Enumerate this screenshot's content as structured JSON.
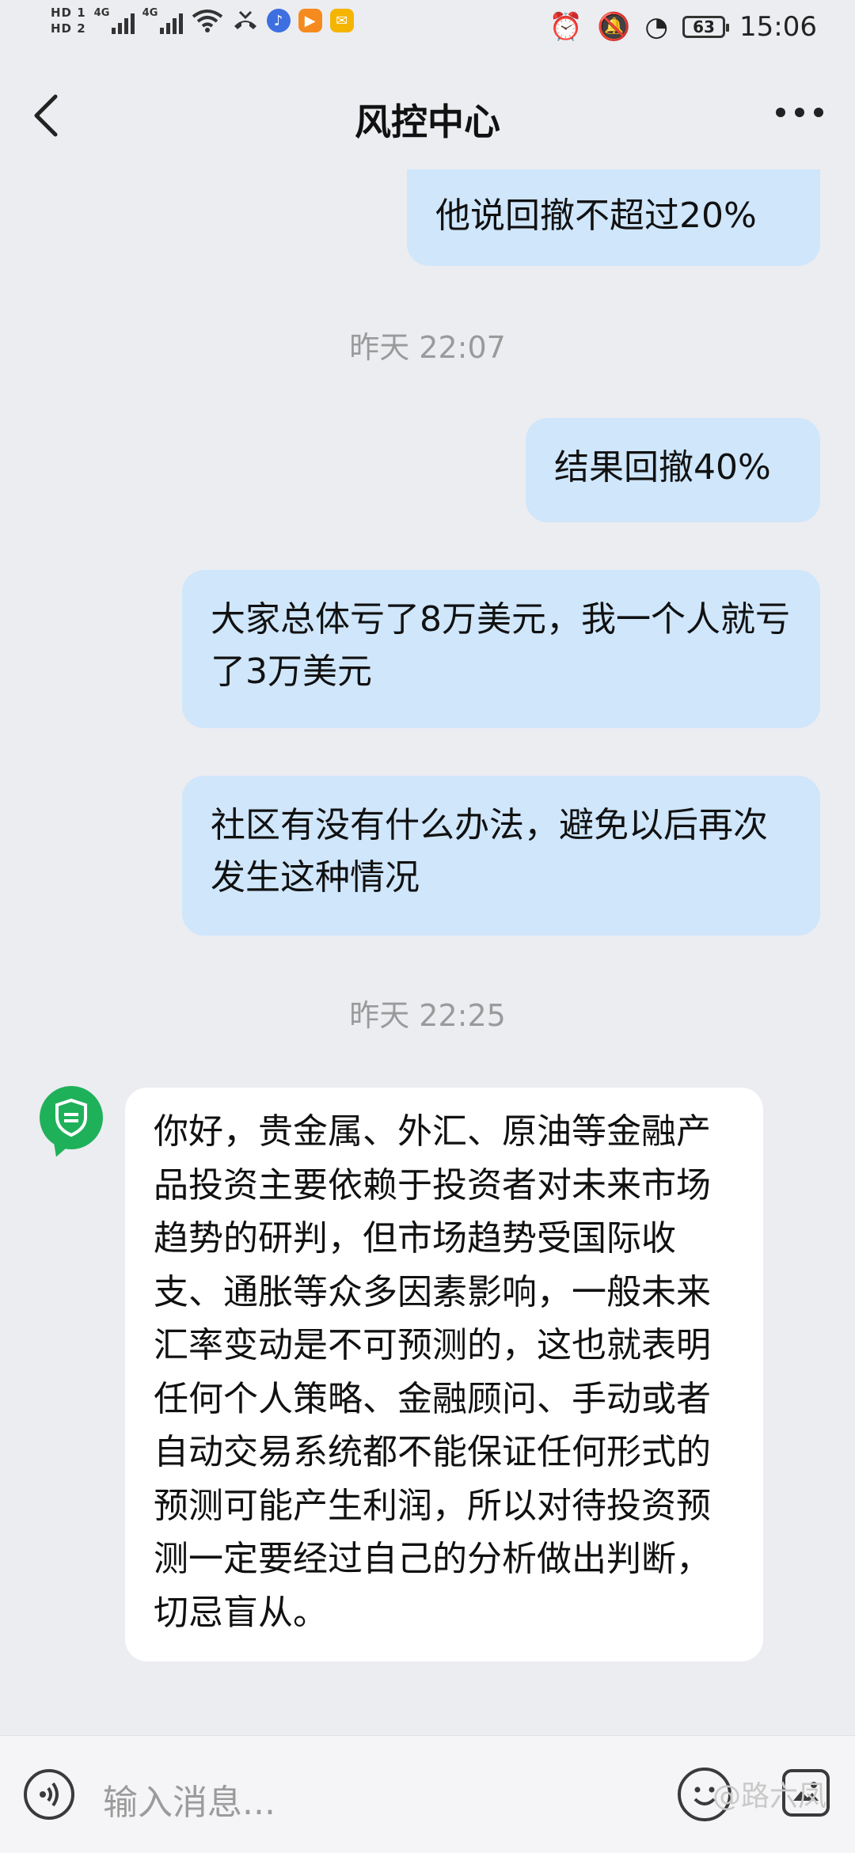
{
  "status_bar": {
    "hd1": "HD 1",
    "hd2": "HD 2",
    "net1": "4G",
    "net2": "4G",
    "battery": "63",
    "time": "15:06"
  },
  "header": {
    "title": "风控中心"
  },
  "messages": [
    {
      "type": "out",
      "text": "他说回撤不超过20%"
    },
    {
      "type": "time",
      "text": "昨天 22:07"
    },
    {
      "type": "out",
      "text": "结果回撤40%"
    },
    {
      "type": "out",
      "text": "大家总体亏了8万美元，我一个人就亏了3万美元"
    },
    {
      "type": "out",
      "text": "社区有没有什么办法，避免以后再次发生这种情况"
    },
    {
      "type": "time",
      "text": "昨天 22:25"
    },
    {
      "type": "in",
      "text": "你好，贵金属、外汇、原油等金融产品投资主要依赖于投资者对未来市场趋势的研判，但市场趋势受国际收支、通胀等众多因素影响，一般未来汇率变动是不可预测的，这也就表明任何个人策略、金融顾问、手动或者自动交易系统都不能保证任何形式的预测可能产生利润，所以对待投资预测一定要经过自己的分析做出判断，切忌盲从。"
    }
  ],
  "input": {
    "placeholder": "输入消息..."
  },
  "watermark": "@路六凤",
  "colors": {
    "outgoing_bubble": "#cfe6fb",
    "incoming_bubble": "#ffffff",
    "avatar": "#1fb15a",
    "background": "#ecedf1"
  }
}
